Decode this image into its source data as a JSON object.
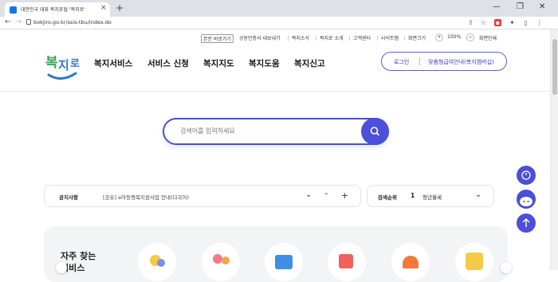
{
  "browser": {
    "tab_title": "대한민국 대표 복지포털 '복지로'",
    "tab_close": "×",
    "new_tab": "+",
    "url": "bokjiro.go.kr/ssis-tbu/index.do",
    "win_min": "—",
    "win_max": "❐",
    "win_close": "✕",
    "back": "←",
    "forward": "→",
    "reload": "↻"
  },
  "util_links": [
    "본문 바로가기",
    "공동인증서 내보내기",
    "복지소식",
    "복지로 소개",
    "고객센터",
    "사이트맵",
    "화면크기",
    "100%",
    "화면인쇄"
  ],
  "zoom": {
    "minus": "−",
    "plus": "+",
    "value": "100%"
  },
  "logo_text": "복지로",
  "gnb": [
    "복지서비스",
    "서비스 신청",
    "복지지도",
    "복지도움",
    "복지신고"
  ],
  "login": {
    "login_label": "로그인",
    "bokji_label": "맞춤형급여안내(복지멤버십)"
  },
  "search": {
    "placeholder": "검색어를 입력하세요"
  },
  "notice": {
    "label": "공지사항",
    "text": "[공유] e아동행복지원사업 안내(다국어)"
  },
  "ranking": {
    "label": "검색순위",
    "rank": "1",
    "keyword": "청년월세"
  },
  "favorites": {
    "title_line1": "자주 찾는",
    "title_line2": "서비스"
  },
  "colors": {
    "primary": "#4b4fd9",
    "logo_green": "#3aa55c",
    "logo_blue": "#2f77c7"
  }
}
